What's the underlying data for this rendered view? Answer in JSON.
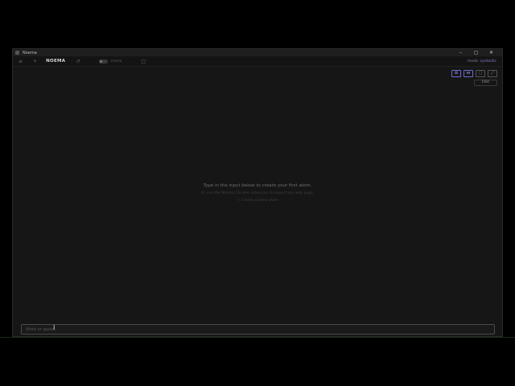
{
  "window": {
    "title": "Noema",
    "controls": {
      "minimize": "–",
      "maximize": "▢",
      "close": "✕"
    }
  },
  "toolbar": {
    "menu_icon": "≡",
    "add_icon": "+",
    "brand": "NOEMA",
    "history_icon": "↺",
    "toggle_label": "media",
    "extra_icon": "□",
    "mode_label": "mode:",
    "mode_value": "syntactic"
  },
  "view_buttons": [
    {
      "name": "graph-view-icon",
      "glyph": "⊞",
      "active": true
    },
    {
      "name": "atoms-view-icon",
      "glyph": "⋈",
      "active": true
    },
    {
      "name": "square-view-icon",
      "glyph": "□",
      "active": false
    },
    {
      "name": "expand-icon",
      "glyph": "⤢",
      "active": false
    }
  ],
  "lang_button": "ENA",
  "empty_state": {
    "line1": "Type in the input below to create your first atom.",
    "line2": "Or use the Noema Chrome extension to import any web page.",
    "line3": "+ Create a blank atom"
  },
  "input": {
    "placeholder": "Write or paste..."
  },
  "colors": {
    "accent": "#8a7fd6",
    "background": "#161616"
  }
}
